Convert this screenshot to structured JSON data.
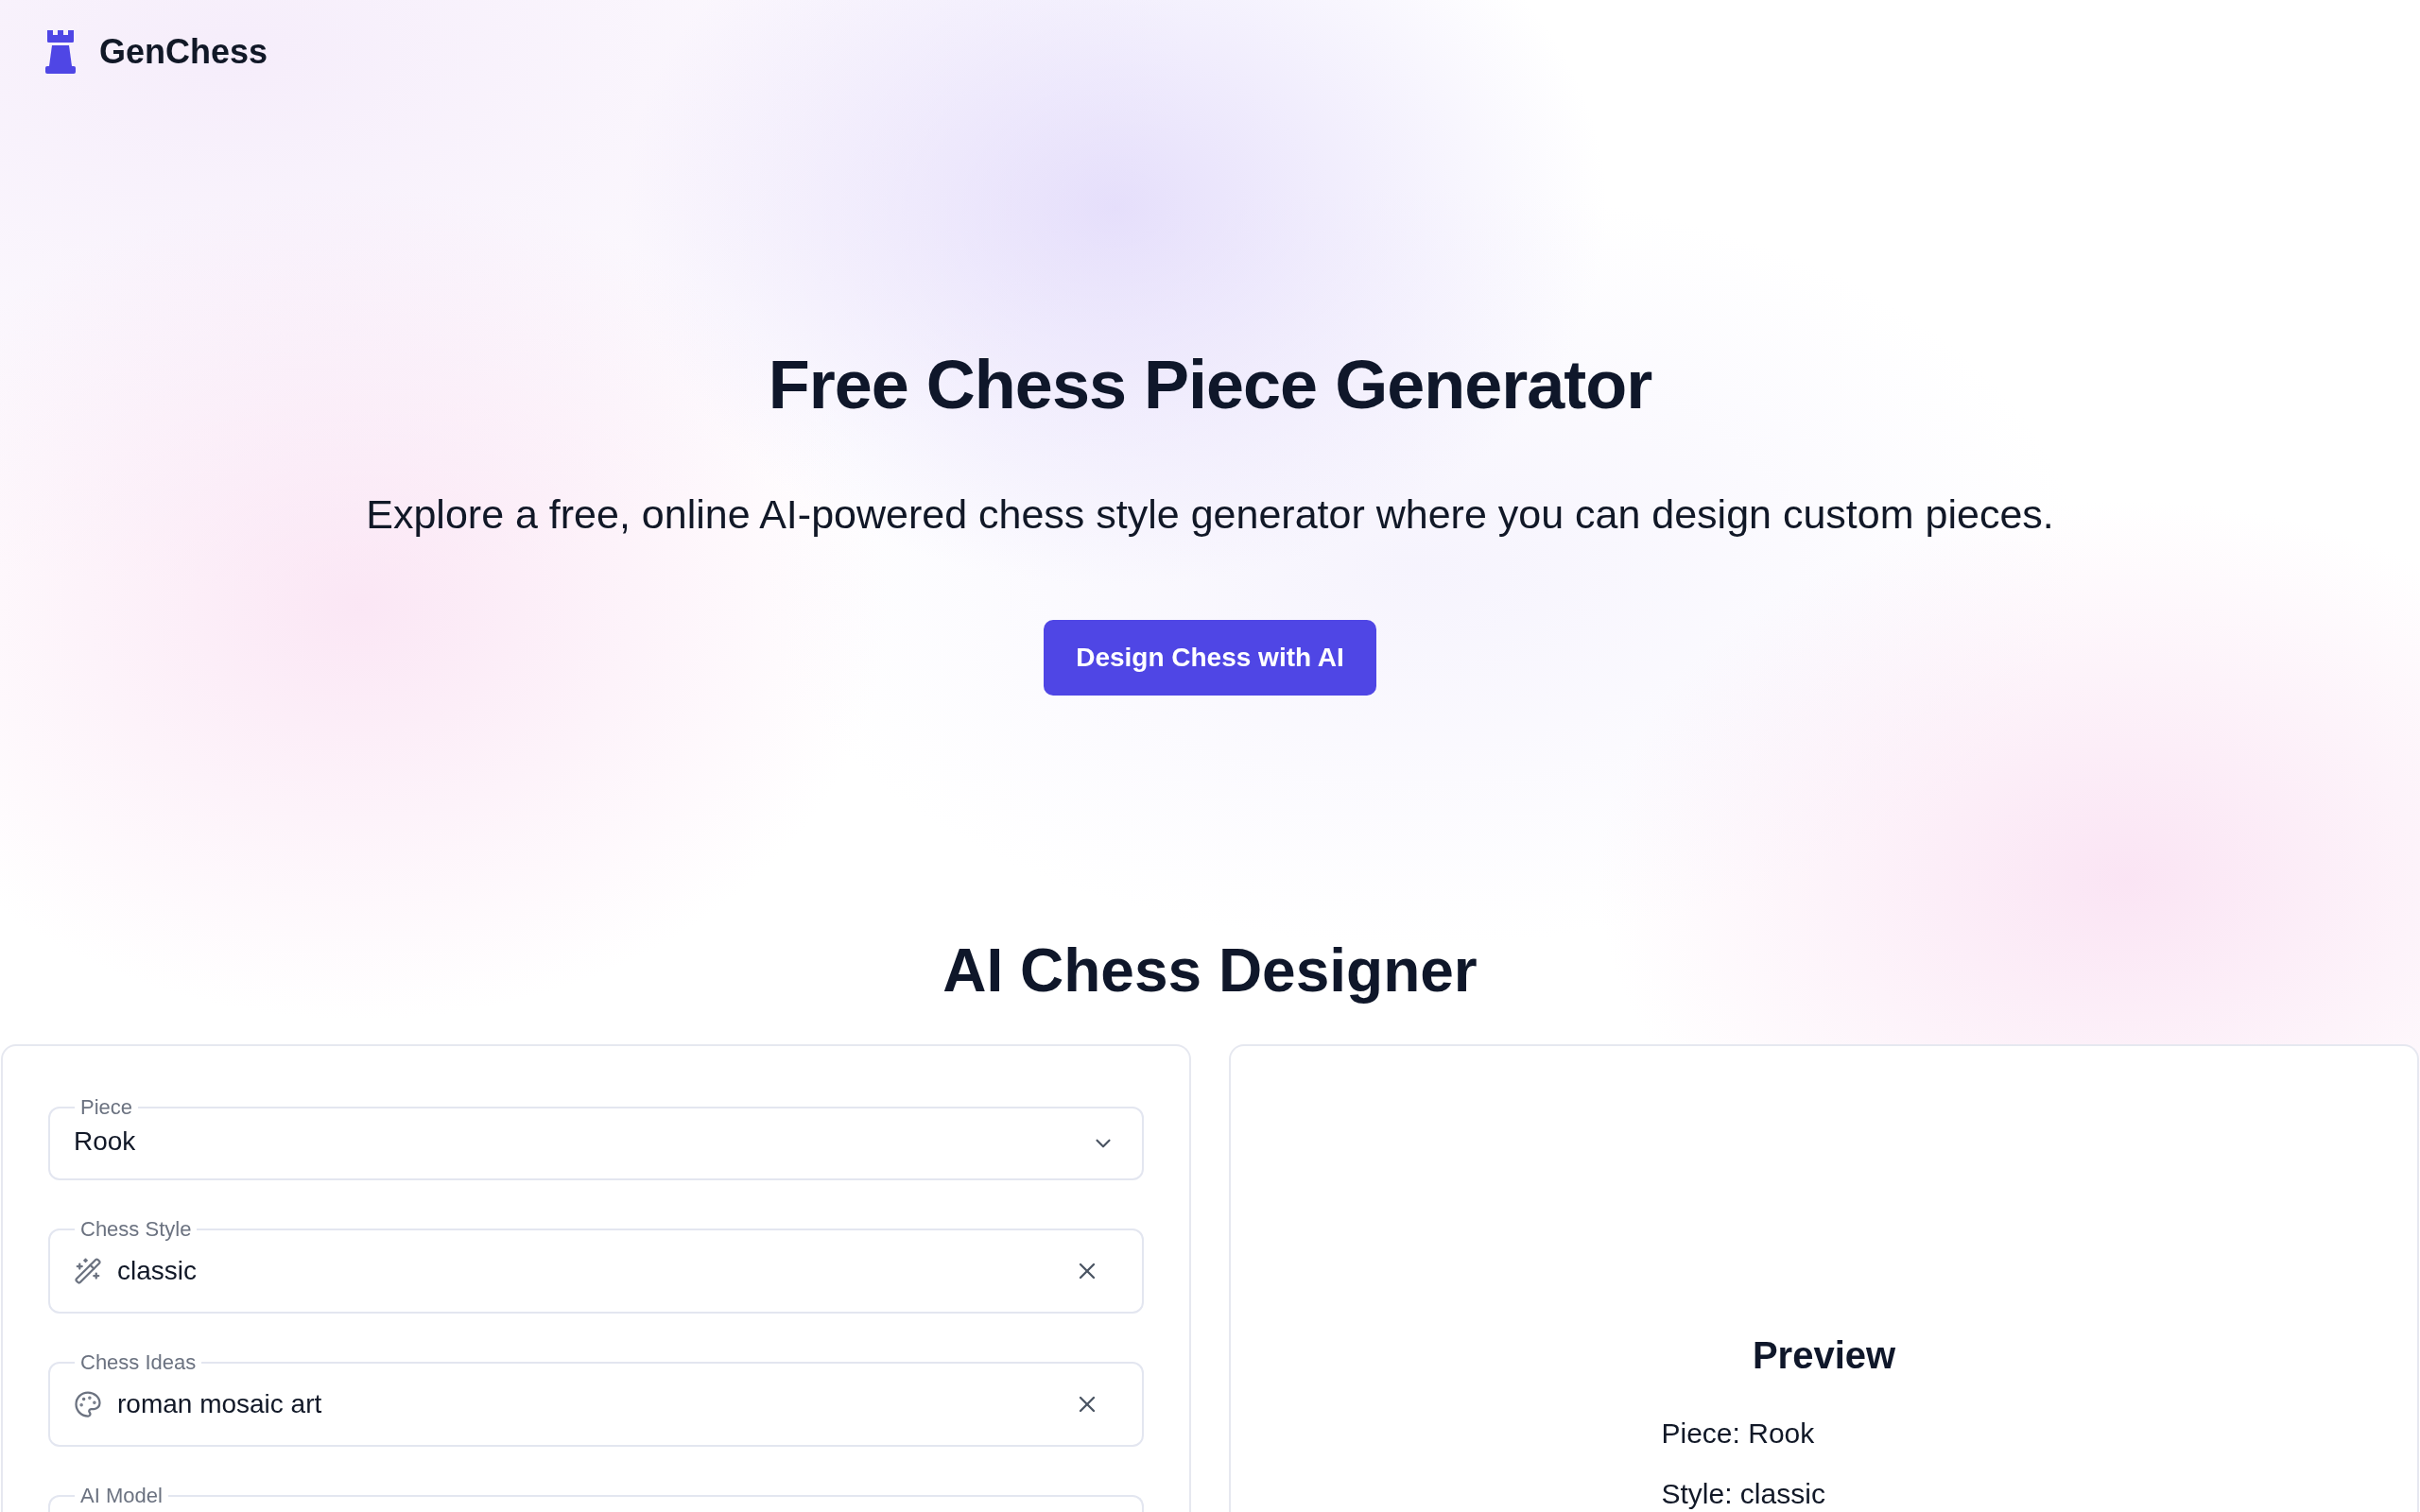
{
  "header": {
    "logo_text": "GenChess"
  },
  "hero": {
    "title": "Free Chess Piece Generator",
    "subtitle": "Explore a free, online AI-powered chess style generator where you can design custom pieces.",
    "cta_button": "Design Chess with AI"
  },
  "designer": {
    "title": "AI Chess Designer",
    "form": {
      "fields": [
        {
          "kind": "select",
          "label": "Piece",
          "value": "Rook"
        },
        {
          "kind": "style",
          "label": "Chess Style",
          "value": "classic"
        },
        {
          "kind": "ideas",
          "label": "Chess Ideas",
          "value": "roman mosaic art"
        },
        {
          "kind": "model",
          "label": "AI Model"
        }
      ]
    },
    "preview": {
      "title": "Preview",
      "lines": [
        "Piece: Rook",
        "Style: classic"
      ]
    }
  }
}
